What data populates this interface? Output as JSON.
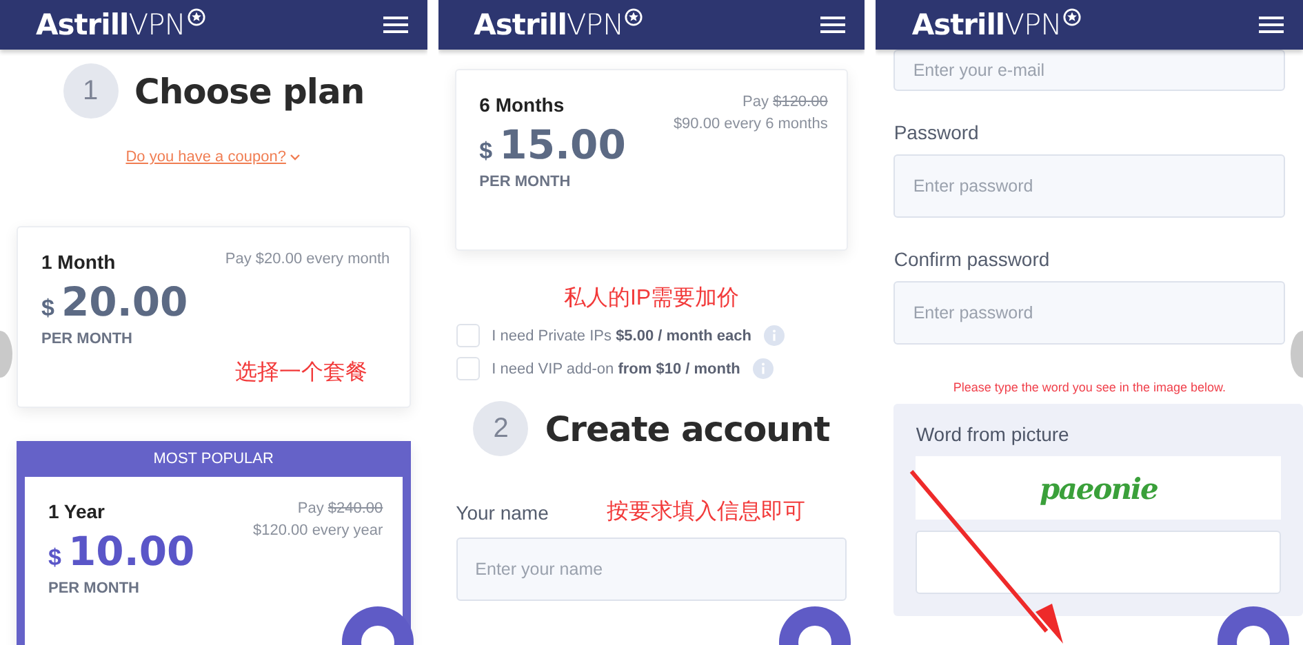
{
  "panels": [
    {
      "header": {
        "logo_strong": "Astrill",
        "logo_light": "VPN"
      },
      "decorations": [
        {
          "kind": "handle_left"
        }
      ],
      "blocks": [
        {
          "kind": "step",
          "number": "1",
          "title": "Choose plan"
        },
        {
          "kind": "coupon",
          "text": "Do you have a coupon?"
        },
        {
          "kind": "plan",
          "highlighted": false,
          "name": "1 Month",
          "currency": "$",
          "price": "20.00",
          "per": "PER MONTH",
          "billing": "Pay $20.00 every month",
          "annotation": "选择一个套餐"
        },
        {
          "kind": "plan",
          "highlighted": true,
          "popular_label": "MOST POPULAR",
          "name": "1 Year",
          "currency": "$",
          "price": "10.00",
          "per": "PER MONTH",
          "pay_prefix": "Pay",
          "pay_old": "$240.00",
          "billing": "$120.00 every year"
        }
      ]
    },
    {
      "header": {
        "logo_strong": "Astrill",
        "logo_light": "VPN"
      },
      "blocks": [
        {
          "kind": "plan",
          "highlighted": false,
          "name": "6 Months",
          "currency": "$",
          "price": "15.00",
          "per": "PER MONTH",
          "pay_prefix": "Pay",
          "pay_old": "$120.00",
          "billing": "$90.00 every 6 months"
        },
        {
          "kind": "note",
          "text": "私人的IP需要加价"
        },
        {
          "kind": "checkbox",
          "checked": false,
          "label": "I need Private IPs **$5.00 / month each**"
        },
        {
          "kind": "checkbox",
          "checked": false,
          "label": "I need VIP add-on **from $10 / month**"
        },
        {
          "kind": "step",
          "number": "2",
          "title": "Create account"
        },
        {
          "kind": "field",
          "label": "Your name",
          "annotation": "按要求填入信息即可",
          "placeholder": "Enter your name"
        }
      ]
    },
    {
      "header": {
        "logo_strong": "Astrill",
        "logo_light": "VPN"
      },
      "decorations": [
        {
          "kind": "handle_right"
        },
        {
          "kind": "arrow"
        }
      ],
      "blocks": [
        {
          "kind": "clipped_field",
          "placeholder": "Enter your e-mail"
        },
        {
          "kind": "field",
          "label": "Password",
          "placeholder": "Enter password"
        },
        {
          "kind": "field",
          "label": "Confirm password",
          "placeholder": "Enter password"
        },
        {
          "kind": "hint",
          "text": "Please type the word you see in the image below."
        },
        {
          "kind": "captcha",
          "label": "Word from picture",
          "word": "paeonie"
        }
      ]
    }
  ]
}
